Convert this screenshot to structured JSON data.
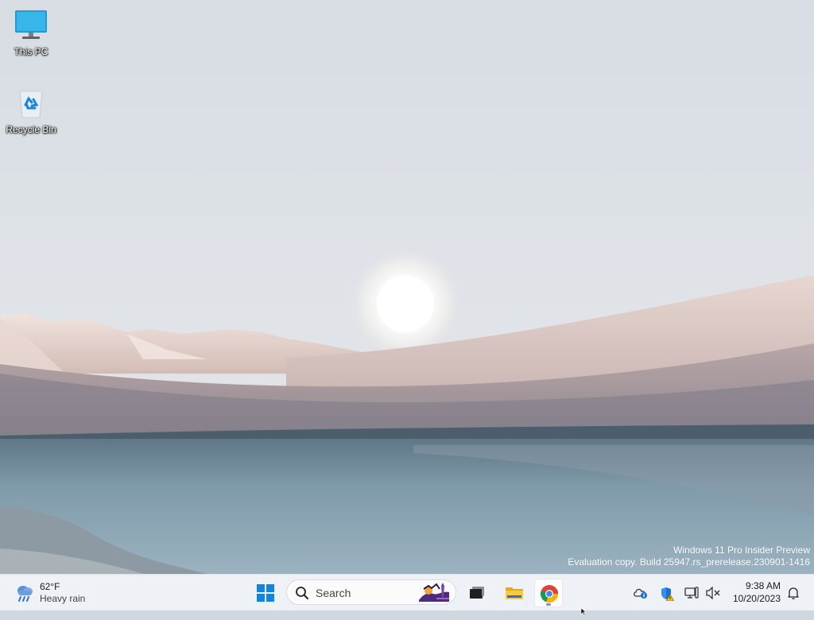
{
  "desktop": {
    "icons": [
      {
        "label": "This PC",
        "icon": "monitor-icon"
      },
      {
        "label": "Recycle Bin",
        "icon": "recycle-bin-icon"
      }
    ],
    "watermark": {
      "line1": "Windows 11 Pro Insider Preview",
      "line2": "Evaluation copy. Build 25947.rs_prerelease.230901-1416"
    }
  },
  "taskbar": {
    "weather": {
      "temperature": "62°F",
      "condition": "Heavy rain",
      "icon": "cloud-rain-icon"
    },
    "start": {
      "icon": "windows-logo-icon"
    },
    "search": {
      "placeholder": "Search",
      "icon": "search-icon"
    },
    "apps": [
      {
        "name": "Task View",
        "icon": "task-view-icon",
        "active": false
      },
      {
        "name": "File Explorer",
        "icon": "folder-icon",
        "active": false
      },
      {
        "name": "Google Chrome",
        "icon": "chrome-icon",
        "active": true
      }
    ],
    "tray": [
      {
        "name": "OneDrive",
        "icon": "onedrive-info-icon"
      },
      {
        "name": "Windows Security",
        "icon": "security-shield-warning-icon"
      },
      {
        "name": "Network",
        "icon": "network-icon"
      },
      {
        "name": "Volume",
        "icon": "volume-muted-icon"
      }
    ],
    "clock": {
      "time": "9:38 AM",
      "date": "10/20/2023"
    },
    "notifications": {
      "icon": "bell-icon"
    }
  },
  "colors": {
    "taskbar_bg": "#eef1f6",
    "accent": "#1383e0",
    "watermark_text": "#ffffff"
  }
}
